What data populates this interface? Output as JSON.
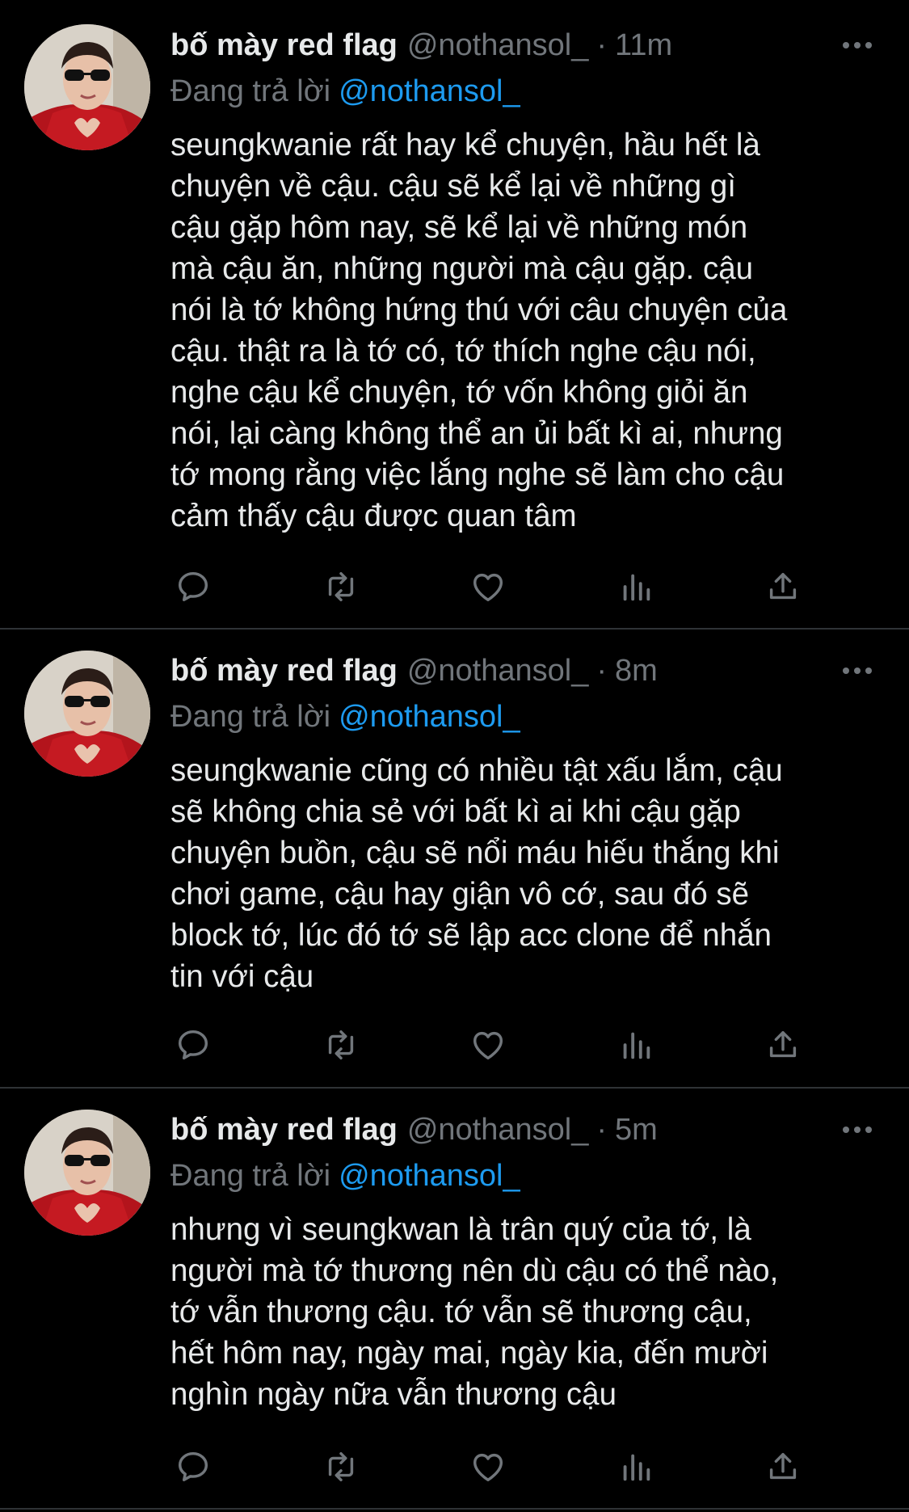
{
  "tweets": [
    {
      "display_name": "bố mày red flag",
      "handle": "@nothansol_",
      "separator": "·",
      "time": "11m",
      "replying_label": "Đang trả lời",
      "replying_to": "@nothansol_",
      "text": "seungkwanie rất hay kể chuyện, hầu hết là\nchuyện về cậu. cậu sẽ kể lại về những gì\ncậu gặp hôm nay, sẽ kể lại về những món\nmà cậu ăn, những người mà cậu gặp. cậu\nnói là tớ không hứng thú với câu chuyện của\ncậu. thật ra là tớ có, tớ thích nghe cậu nói,\nnghe cậu kể chuyện, tớ vốn không giỏi ăn\nnói, lại càng không thể an ủi bất kì ai, nhưng\ntớ mong rằng việc lắng nghe sẽ làm cho cậu\ncảm thấy cậu được quan tâm"
    },
    {
      "display_name": "bố mày red flag",
      "handle": "@nothansol_",
      "separator": "·",
      "time": "8m",
      "replying_label": "Đang trả lời",
      "replying_to": "@nothansol_",
      "text": "seungkwanie cũng có nhiều tật xấu lắm, cậu\nsẽ không chia sẻ với bất kì ai khi cậu gặp\nchuyện buồn, cậu sẽ nổi máu hiếu thắng khi\nchơi game, cậu hay giận vô cớ, sau đó sẽ\nblock tớ, lúc đó tớ sẽ lập acc clone để nhắn\ntin với cậu"
    },
    {
      "display_name": "bố mày red flag",
      "handle": "@nothansol_",
      "separator": "·",
      "time": "5m",
      "replying_label": "Đang trả lời",
      "replying_to": "@nothansol_",
      "text": "nhưng vì seungkwan là trân quý của tớ, là\nngười mà tớ thương nên dù cậu có thể nào,\ntớ vẫn thương cậu. tớ vẫn sẽ thương cậu,\nhết hôm nay, ngày mai, ngày kia, đến mười\nnghìn ngày nữa vẫn thương cậu"
    }
  ],
  "icons": {
    "more": "more-horizontal-icon",
    "reply": "reply-icon",
    "retweet": "retweet-icon",
    "like": "like-icon",
    "views": "views-icon",
    "share": "share-icon"
  },
  "colors": {
    "background": "#000000",
    "text": "#e7e9ea",
    "secondary": "#71767b",
    "link": "#1d9bf0",
    "divider": "#2f3336"
  }
}
